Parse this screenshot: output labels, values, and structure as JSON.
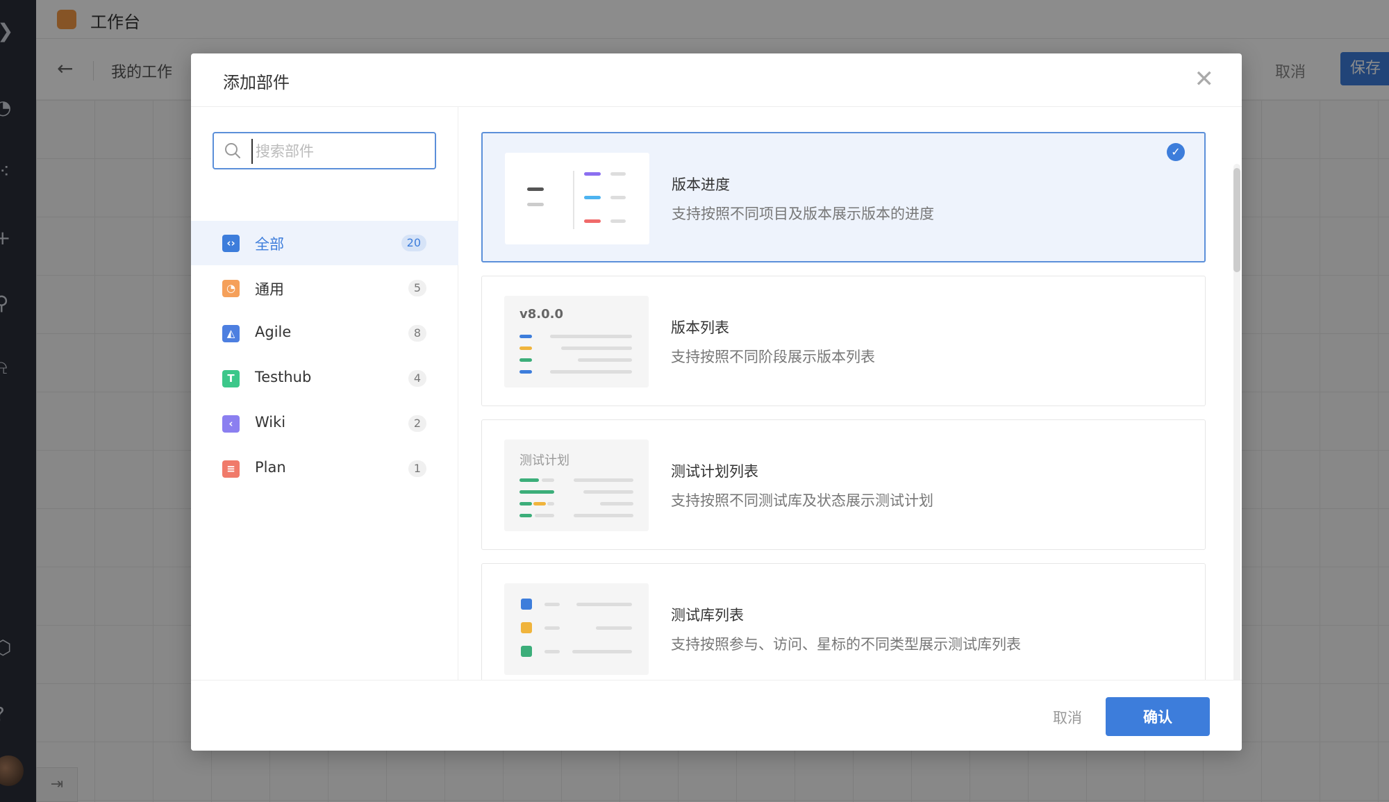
{
  "app": {
    "title": "工作台",
    "breadcrumb": "我的工作",
    "cancel_label": "取消",
    "save_label": "保存"
  },
  "modal": {
    "title": "添加部件",
    "search_placeholder": "搜索部件",
    "categories": [
      {
        "label": "全部",
        "count": "20",
        "icon": "all-icon",
        "color": "#3d7ddb",
        "active": true
      },
      {
        "label": "通用",
        "count": "5",
        "icon": "general-icon",
        "color": "#f5a05a"
      },
      {
        "label": "Agile",
        "count": "8",
        "icon": "agile-icon",
        "color": "#4d7fe0"
      },
      {
        "label": "Testhub",
        "count": "4",
        "icon": "testhub-icon",
        "color": "#3cc78a"
      },
      {
        "label": "Wiki",
        "count": "2",
        "icon": "wiki-icon",
        "color": "#8b7ff0"
      },
      {
        "label": "Plan",
        "count": "1",
        "icon": "plan-icon",
        "color": "#f07a6a"
      }
    ],
    "widgets": [
      {
        "title": "版本进度",
        "description": "支持按照不同项目及版本展示版本的进度",
        "selected": true
      },
      {
        "title": "版本列表",
        "description": "支持按照不同阶段展示版本列表",
        "thumb_label": "v8.0.0"
      },
      {
        "title": "测试计划列表",
        "description": "支持按照不同测试库及状态展示测试计划",
        "thumb_label": "测试计划"
      },
      {
        "title": "测试库列表",
        "description": "支持按照参与、访问、星标的不同类型展示测试库列表"
      }
    ],
    "cancel_label": "取消",
    "confirm_label": "确认"
  },
  "colors": {
    "accent": "#3d7ddb",
    "selected_bg": "#eef3fc"
  }
}
